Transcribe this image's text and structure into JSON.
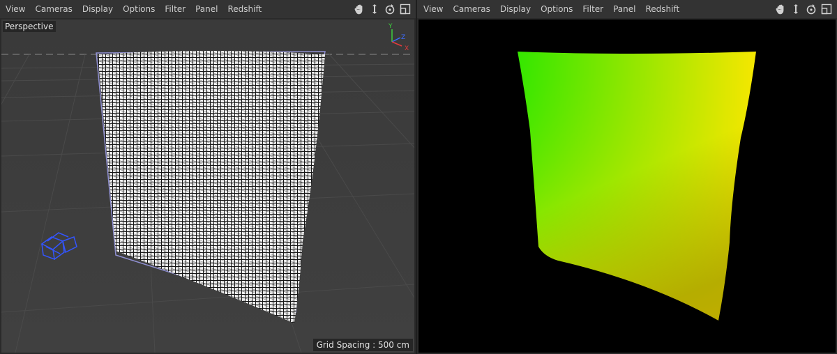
{
  "left_viewport": {
    "menu": [
      "View",
      "Cameras",
      "Display",
      "Options",
      "Filter",
      "Panel",
      "Redshift"
    ],
    "title": "Perspective",
    "grid_spacing": "Grid Spacing : 500 cm",
    "axis_labels": {
      "y": "Y",
      "z": "Z",
      "x": "X"
    }
  },
  "right_viewport": {
    "menu": [
      "View",
      "Cameras",
      "Display",
      "Options",
      "Filter",
      "Panel",
      "Redshift"
    ]
  },
  "nav_icons": [
    "hand-move-icon",
    "arrow-move-icon",
    "rotate-icon",
    "maximize-view-icon"
  ],
  "colors": {
    "menubar": "#333333",
    "viewport_bg": "#3a3a3a",
    "render_bg": "#000000",
    "wire": "#ffffff",
    "camera_blue": "#3355ff"
  }
}
